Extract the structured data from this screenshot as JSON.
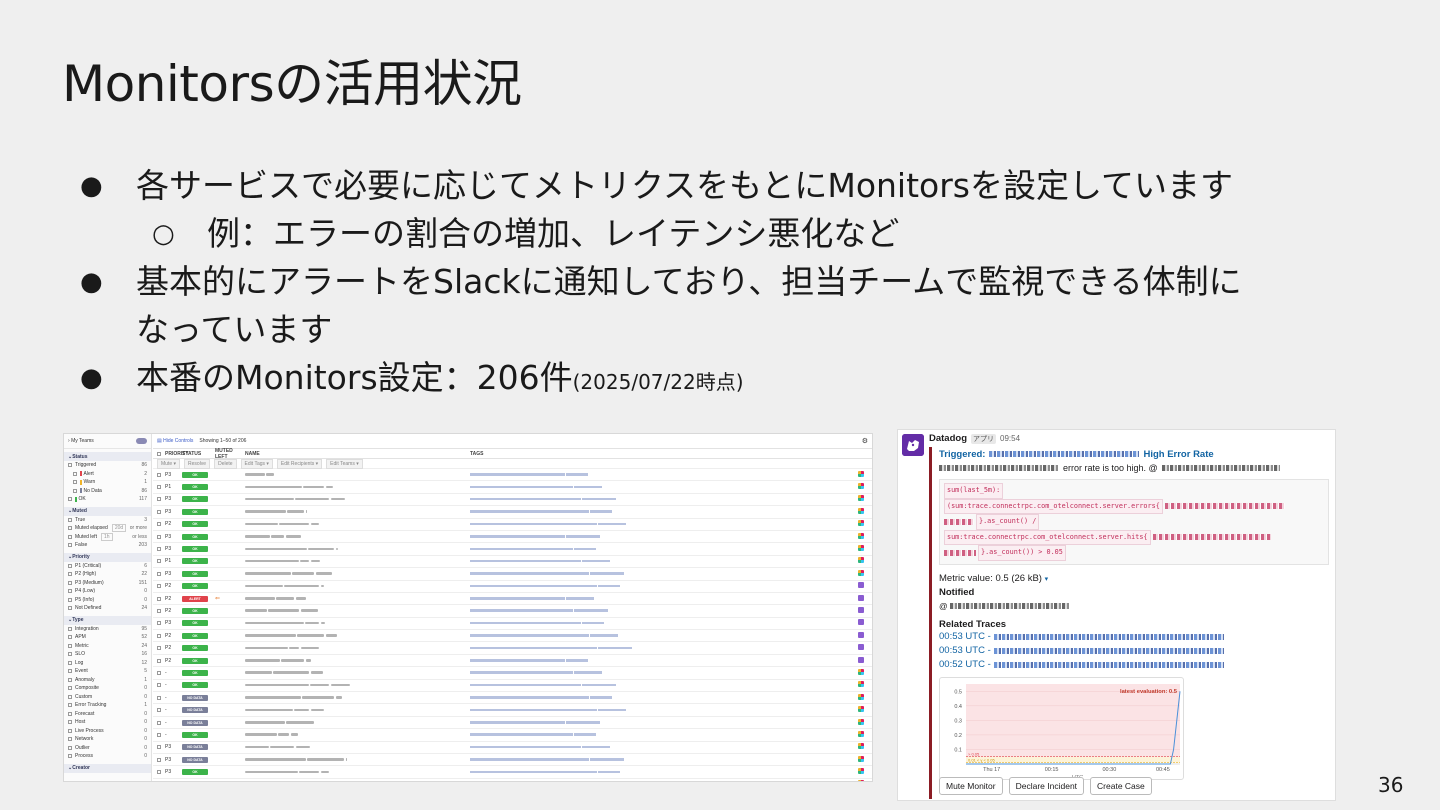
{
  "slide": {
    "title": "Monitorsの活用状況",
    "page_number": "36"
  },
  "bullets": [
    {
      "text": "各サービスで必要に応じてメトリクスをもとにMonitorsを設定しています",
      "sub": [
        "例：エラーの割合の増加、レイテンシ悪化など"
      ]
    },
    {
      "text": "基本的にアラートをSlackに通知しており、担当チームで監視できる体制に",
      "cont": "なっています"
    },
    {
      "text": "本番のMonitors設定：206件",
      "small": "(2025/07/22時点)"
    }
  ],
  "monitor_list": {
    "team_label": "My Teams",
    "hide_controls": "Hide Controls",
    "showing": "Showing 1–50 of 206",
    "columns": [
      "PRIORITY",
      "STATUS",
      "MUTED LEFT",
      "NAME",
      "TAGS"
    ],
    "filter_chips": [
      "Mute ▾",
      "Resolve",
      "Delete",
      "Edit Tags ▾",
      "Edit Recipients ▾",
      "Edit Teams ▾"
    ],
    "facets": [
      {
        "title": "Status",
        "items": [
          {
            "label": "Triggered",
            "count": "86"
          },
          {
            "label": "Alert",
            "count": "2",
            "mark": "#e0434b",
            "indent": true
          },
          {
            "label": "Warn",
            "count": "1",
            "mark": "#f0b429",
            "indent": true
          },
          {
            "label": "No Data",
            "count": "86",
            "mark": "#7a7f99",
            "indent": true
          },
          {
            "label": "OK",
            "count": "117",
            "mark": "#3cb34a"
          }
        ]
      },
      {
        "title": "Muted",
        "items": [
          {
            "label": "True",
            "count": "3"
          },
          {
            "label": "Muted elapsed",
            "count": "or more",
            "box": "20d"
          },
          {
            "label": "Muted left",
            "count": "or less",
            "box": "1h"
          },
          {
            "label": "False",
            "count": "203"
          }
        ]
      },
      {
        "title": "Priority",
        "items": [
          {
            "label": "P1 (Critical)",
            "count": "6"
          },
          {
            "label": "P2 (High)",
            "count": "22"
          },
          {
            "label": "P3 (Medium)",
            "count": "151"
          },
          {
            "label": "P4 (Low)",
            "count": "0"
          },
          {
            "label": "P5 (Info)",
            "count": "0"
          },
          {
            "label": "Not Defined",
            "count": "24"
          }
        ]
      },
      {
        "title": "Type",
        "items": [
          {
            "label": "Integration",
            "count": "95"
          },
          {
            "label": "APM",
            "count": "52"
          },
          {
            "label": "Metric",
            "count": "24"
          },
          {
            "label": "SLO",
            "count": "16"
          },
          {
            "label": "Log",
            "count": "12"
          },
          {
            "label": "Event",
            "count": "5"
          },
          {
            "label": "Anomaly",
            "count": "1"
          },
          {
            "label": "Composite",
            "count": "0"
          },
          {
            "label": "Custom",
            "count": "0"
          },
          {
            "label": "Error Tracking",
            "count": "1"
          },
          {
            "label": "Forecast",
            "count": "0"
          },
          {
            "label": "Host",
            "count": "0"
          },
          {
            "label": "Live Process",
            "count": "0"
          },
          {
            "label": "Network",
            "count": "0"
          },
          {
            "label": "Outlier",
            "count": "0"
          },
          {
            "label": "Process",
            "count": "0"
          }
        ]
      },
      {
        "title": "Creator",
        "items": []
      }
    ],
    "rows": [
      {
        "priority": "P3",
        "status": "OK",
        "icon": "slack"
      },
      {
        "priority": "P1",
        "status": "OK",
        "icon": "slack"
      },
      {
        "priority": "P3",
        "status": "OK",
        "icon": "slack"
      },
      {
        "priority": "P3",
        "status": "OK",
        "icon": "slack"
      },
      {
        "priority": "P2",
        "status": "OK",
        "icon": "slack"
      },
      {
        "priority": "P3",
        "status": "OK",
        "icon": "slack"
      },
      {
        "priority": "P3",
        "status": "OK",
        "icon": "slack"
      },
      {
        "priority": "P1",
        "status": "OK",
        "icon": "slack"
      },
      {
        "priority": "P3",
        "status": "OK",
        "icon": "slack"
      },
      {
        "priority": "P2",
        "status": "OK",
        "icon": "purple"
      },
      {
        "priority": "P2",
        "status": "ALERT",
        "icon": "purple",
        "alert_arrow": true
      },
      {
        "priority": "P2",
        "status": "OK",
        "icon": "purple"
      },
      {
        "priority": "P3",
        "status": "OK",
        "icon": "purple"
      },
      {
        "priority": "P2",
        "status": "OK",
        "icon": "purple"
      },
      {
        "priority": "P2",
        "status": "OK",
        "icon": "purple"
      },
      {
        "priority": "P2",
        "status": "OK",
        "icon": "purple"
      },
      {
        "priority": "-",
        "status": "OK",
        "icon": "slack"
      },
      {
        "priority": "-",
        "status": "OK",
        "icon": "slack"
      },
      {
        "priority": "-",
        "status": "NO DATA",
        "icon": "slack"
      },
      {
        "priority": "-",
        "status": "NO DATA",
        "icon": "slack"
      },
      {
        "priority": "-",
        "status": "NO DATA",
        "icon": "slack"
      },
      {
        "priority": "-",
        "status": "OK",
        "icon": "slack"
      },
      {
        "priority": "P3",
        "status": "NO DATA",
        "icon": "slack"
      },
      {
        "priority": "P3",
        "status": "NO DATA",
        "icon": "slack"
      },
      {
        "priority": "P3",
        "status": "OK",
        "icon": "slack"
      },
      {
        "priority": "P3",
        "status": "OK",
        "icon": "slack"
      }
    ],
    "status_colors": {
      "OK": "#3cb34a",
      "ALERT": "#e0434b",
      "NO DATA": "#7a7f99"
    }
  },
  "slack_message": {
    "sender": "Datadog",
    "app_badge": "アプリ",
    "time": "09:54",
    "triggered_prefix": "Triggered:",
    "triggered_suffix": "High Error Rate",
    "error_text": "error rate is too high. @",
    "code_lines": [
      "sum(last_5m):",
      "(sum:trace.connectrpc.com_otelconnect.server.errors{",
      "}.as_count() /",
      "sum:trace.connectrpc.com_otelconnect.server.hits{",
      "}.as_count()) > 0.05"
    ],
    "metric_value": "Metric value: 0.5 (26 kB)",
    "notified_label": "Notified",
    "notified_at": "@",
    "related_label": "Related Traces",
    "traces": [
      "00:53 UTC -",
      "00:53 UTC -",
      "00:52 UTC -"
    ],
    "chart_annotation": "latest evaluation: 0.5",
    "threshold_labels": [
      "> 0.05",
      "0.01 < y < 0.05"
    ],
    "buttons": [
      "Mute Monitor",
      "Declare Incident",
      "Create Case"
    ],
    "brand_color": "#632ca6",
    "alert_bar_color": "#8b1c24",
    "link_color": "#1264a3"
  },
  "chart_data": {
    "type": "line",
    "x_ticks": [
      "Thu 17",
      "00:15",
      "00:30",
      "00:45"
    ],
    "xlabel": "UTC",
    "y_ticks": [
      0.1,
      0.2,
      0.3,
      0.4,
      0.5
    ],
    "ylim": [
      0,
      0.55
    ],
    "series": [
      {
        "x": [
          0,
          0.15,
          0.3,
          0.45,
          0.6,
          0.75,
          0.88,
          0.955,
          0.97,
          1.0
        ],
        "values": [
          0,
          0,
          0,
          0,
          0,
          0,
          0,
          0,
          0.1,
          0.5
        ]
      }
    ],
    "thresholds": {
      "alert": 0.05,
      "warning": 0.01
    }
  }
}
